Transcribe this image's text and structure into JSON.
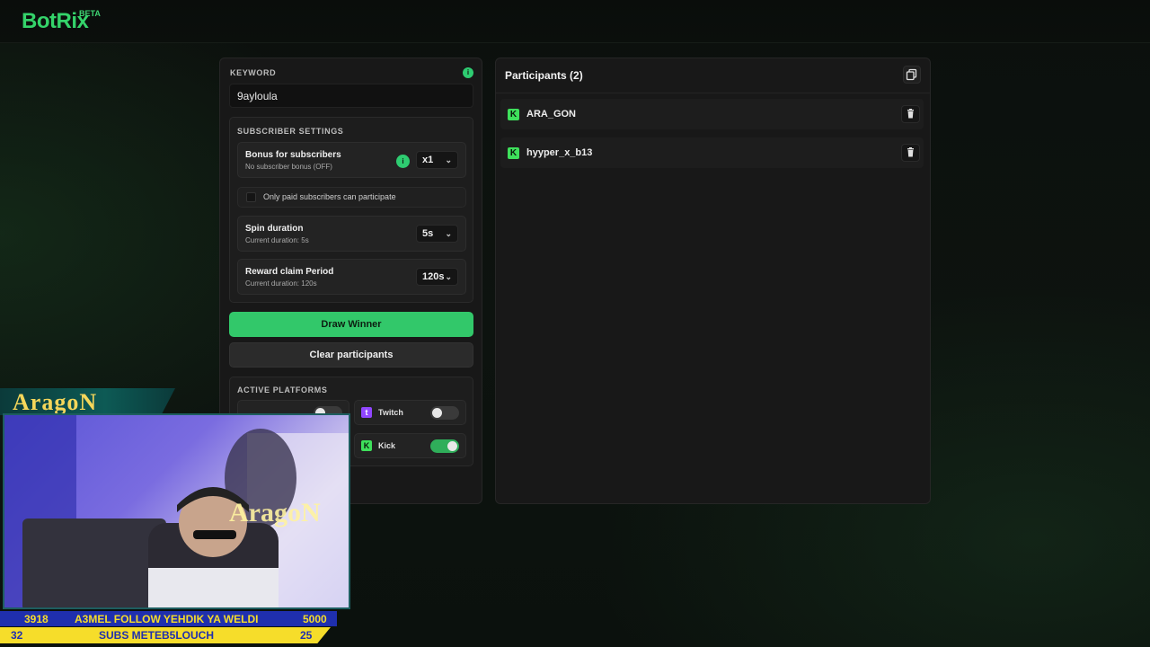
{
  "brand": {
    "name": "BotRix",
    "badge": "BETA"
  },
  "keyword": {
    "label": "KEYWORD",
    "value": "9ayloula",
    "info": "i"
  },
  "subscriber_settings": {
    "label": "SUBSCRIBER SETTINGS",
    "bonus": {
      "title": "Bonus for subscribers",
      "subtitle": "No subscriber bonus (OFF)",
      "info": "i",
      "value": "x1"
    },
    "paid_only": {
      "label": "Only paid subscribers can participate",
      "checked": false
    },
    "spin": {
      "title": "Spin duration",
      "subtitle": "Current duration: 5s",
      "value": "5s"
    },
    "reward": {
      "title": "Reward claim Period",
      "subtitle": "Current duration: 120s",
      "value": "120s"
    }
  },
  "actions": {
    "draw": "Draw Winner",
    "clear": "Clear participants"
  },
  "platforms": {
    "label": "ACTIVE PLATFORMS",
    "items": [
      {
        "name": "Twitch",
        "enabled": false,
        "color": "#9146ff"
      },
      {
        "name": "Kick",
        "enabled": true,
        "color": "#3ee05b"
      }
    ]
  },
  "participants": {
    "title": "Participants (2)",
    "list": [
      {
        "name": "ARA_GON",
        "platform": "kick-icon"
      },
      {
        "name": "hyyper_x_b13",
        "platform": "kick-icon"
      }
    ]
  },
  "stream_overlay": {
    "streamer_name": "AragoN",
    "ticker_followers": {
      "current": "3918",
      "text": "A3MEL FOLLOW YEHDIK YA WELDI",
      "goal": "5000"
    },
    "ticker_subs": {
      "current": "32",
      "text": "SUBS METEB5LOUCH",
      "goal": "25"
    }
  },
  "colors": {
    "accent": "#32c86a",
    "background": "#0d120f",
    "panel": "#181818"
  }
}
